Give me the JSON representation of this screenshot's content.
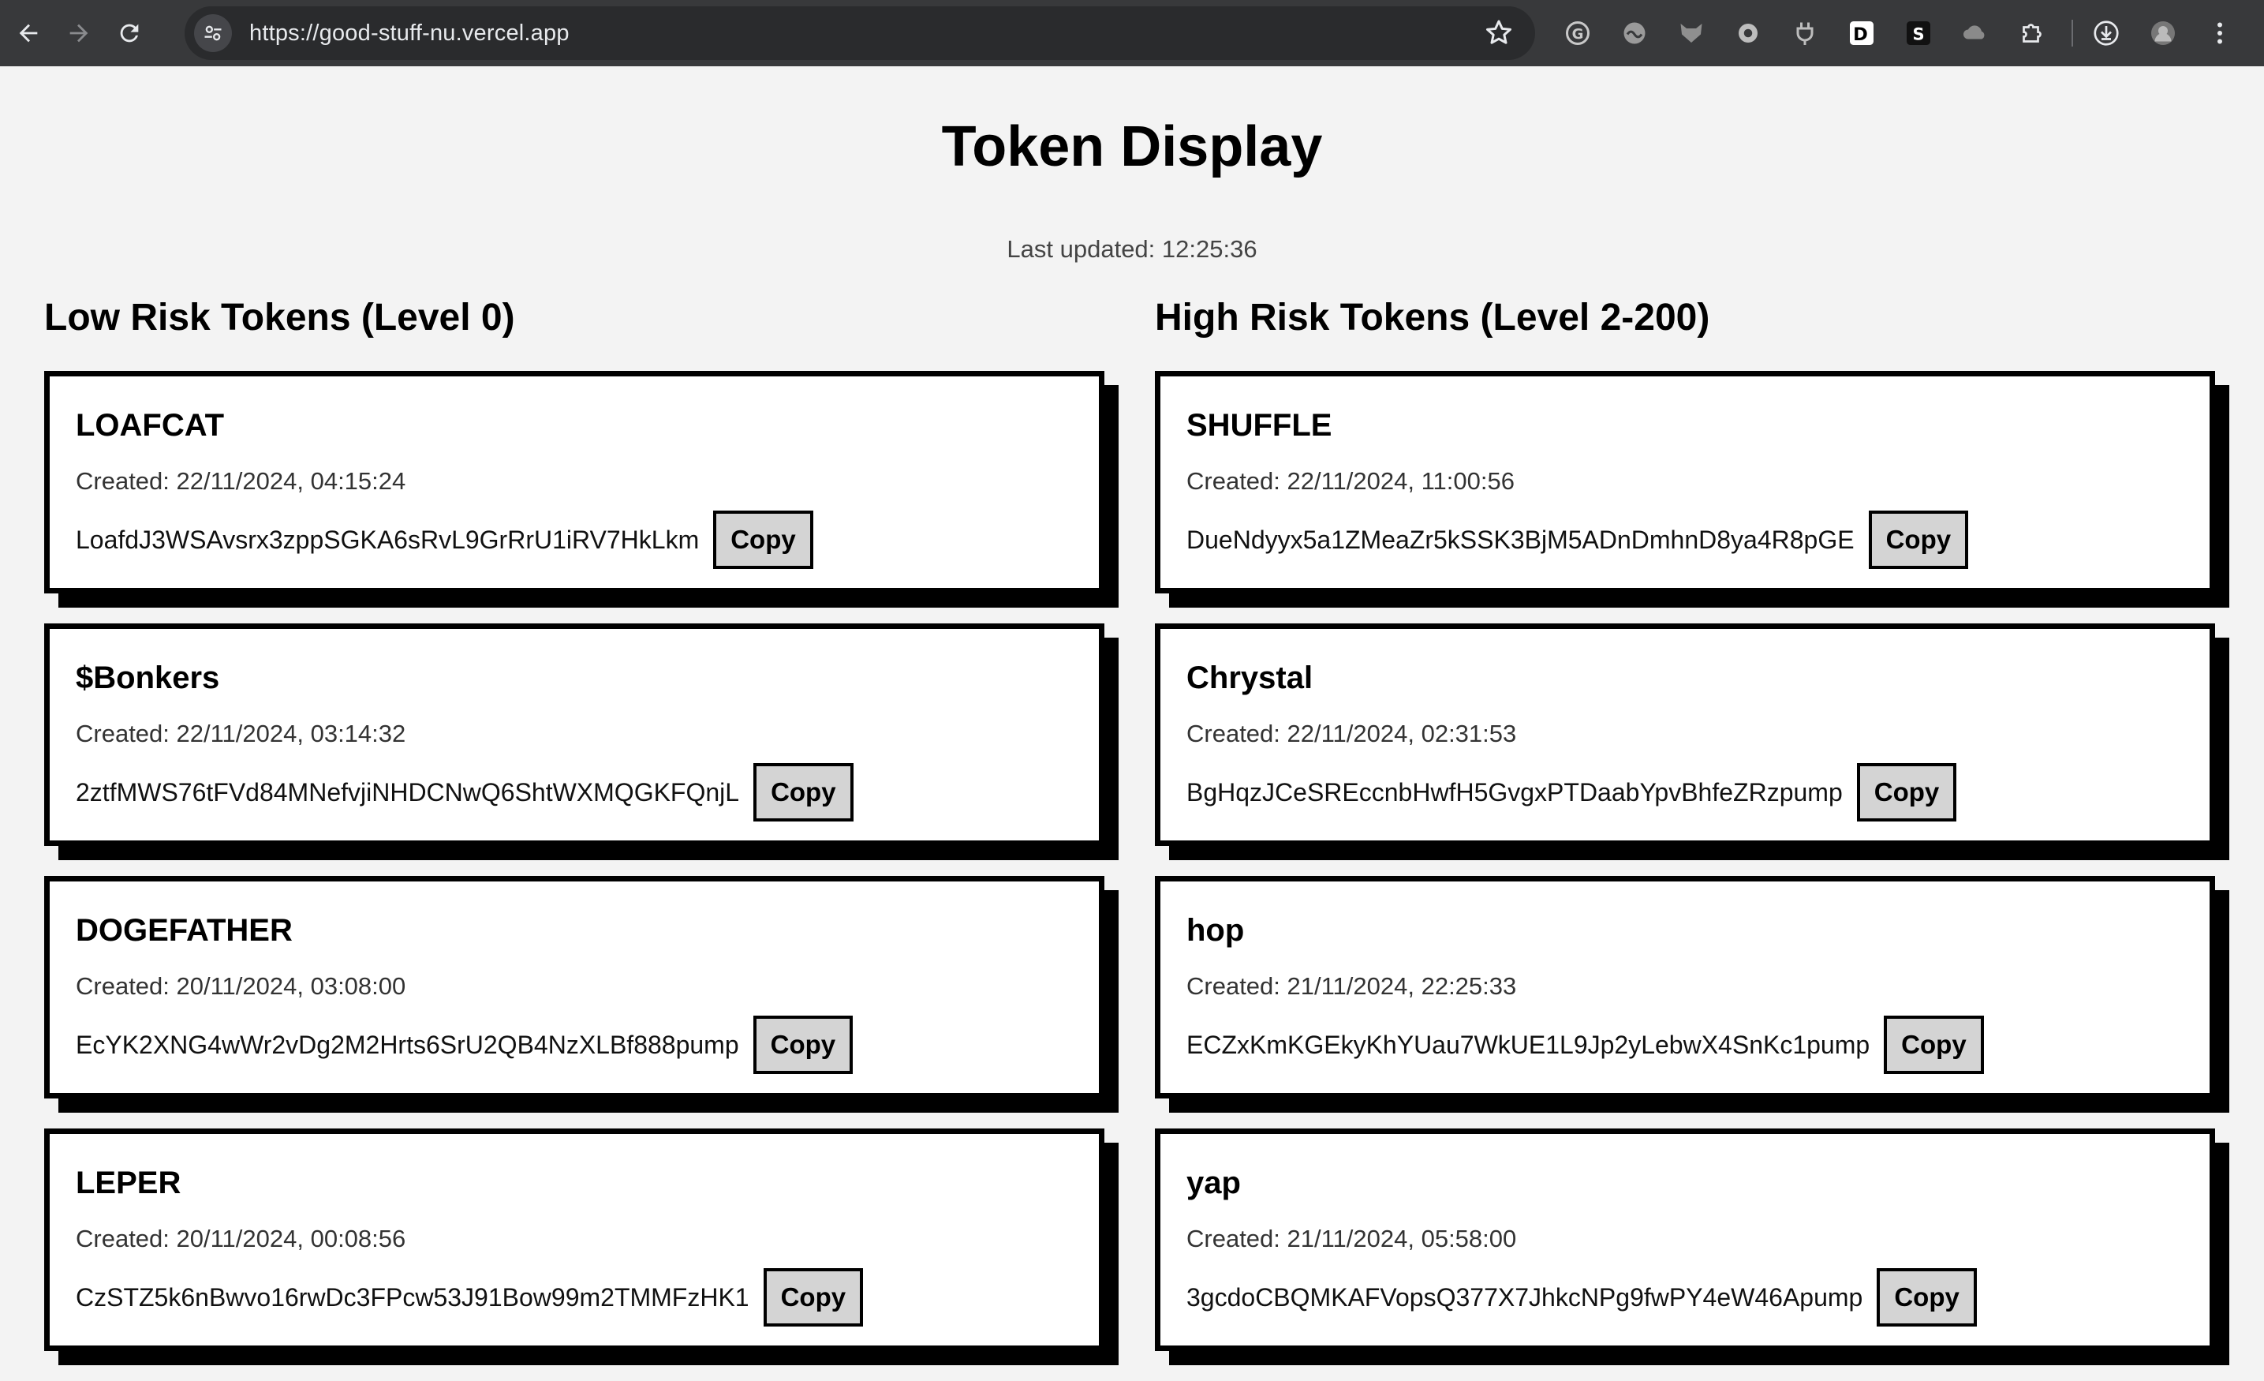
{
  "browser": {
    "url": "https://good-stuff-nu.vercel.app",
    "extensions": [
      "grammarly-icon",
      "vpn-icon",
      "fox-icon",
      "record-icon",
      "plug-icon",
      "d-icon",
      "s-icon",
      "cloud-icon",
      "puzzle-icon"
    ]
  },
  "page": {
    "title": "Token Display",
    "last_updated": "Last updated: 12:25:36"
  },
  "low_risk": {
    "heading": "Low Risk Tokens (Level 0)",
    "tokens": [
      {
        "name": "LOAFCAT",
        "created": "Created: 22/11/2024, 04:15:24",
        "address": "LoafdJ3WSAvsrx3zppSGKA6sRvL9GrRrU1iRV7HkLkm",
        "copy": "Copy"
      },
      {
        "name": "$Bonkers",
        "created": "Created: 22/11/2024, 03:14:32",
        "address": "2ztfMWS76tFVd84MNefvjiNHDCNwQ6ShtWXMQGKFQnjL",
        "copy": "Copy"
      },
      {
        "name": "DOGEFATHER",
        "created": "Created: 20/11/2024, 03:08:00",
        "address": "EcYK2XNG4wWr2vDg2M2Hrts6SrU2QB4NzXLBf888pump",
        "copy": "Copy"
      },
      {
        "name": "LEPER",
        "created": "Created: 20/11/2024, 00:08:56",
        "address": "CzSTZ5k6nBwvo16rwDc3FPcw53J91Bow99m2TMMFzHK1",
        "copy": "Copy"
      }
    ]
  },
  "high_risk": {
    "heading": "High Risk Tokens (Level 2-200)",
    "tokens": [
      {
        "name": "SHUFFLE",
        "created": "Created: 22/11/2024, 11:00:56",
        "address": "DueNdyyx5a1ZMeaZr5kSSK3BjM5ADnDmhnD8ya4R8pGE",
        "copy": "Copy"
      },
      {
        "name": "Chrystal",
        "created": "Created: 22/11/2024, 02:31:53",
        "address": "BgHqzJCeSREccnbHwfH5GvgxPTDaabYpvBhfeZRzpump",
        "copy": "Copy"
      },
      {
        "name": "hop",
        "created": "Created: 21/11/2024, 22:25:33",
        "address": "ECZxKmKGEkyKhYUau7WkUE1L9Jp2yLebwX4SnKc1pump",
        "copy": "Copy"
      },
      {
        "name": "yap",
        "created": "Created: 21/11/2024, 05:58:00",
        "address": "3gcdoCBQMKAFVopsQ377X7JhkcNPg9fwPY4eW46Apump",
        "copy": "Copy"
      }
    ]
  }
}
